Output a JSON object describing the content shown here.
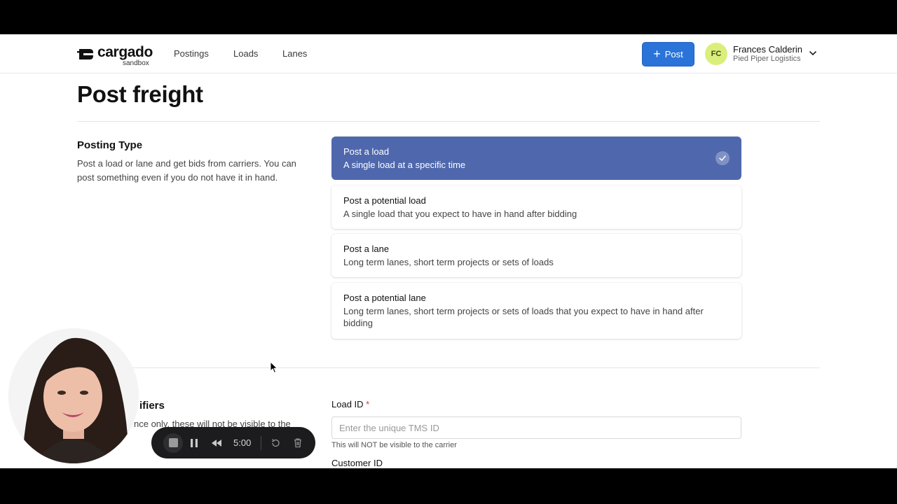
{
  "header": {
    "logo_text": "cargado",
    "logo_sub": "sandbox",
    "nav": [
      "Postings",
      "Loads",
      "Lanes"
    ],
    "post_button": "Post",
    "user_initials": "FC",
    "user_name": "Frances Calderin",
    "user_org": "Pied Piper Logistics"
  },
  "page": {
    "title": "Post freight"
  },
  "posting_type": {
    "title": "Posting Type",
    "description": "Post a load or lane and get bids from carriers. You can post something even if you do not have it in hand.",
    "options": [
      {
        "title": "Post a load",
        "description": "A single load at a specific time",
        "selected": true
      },
      {
        "title": "Post a potential load",
        "description": "A single load that you expect to have in hand after bidding",
        "selected": false
      },
      {
        "title": "Post a lane",
        "description": "Long term lanes, short term projects or sets of loads",
        "selected": false
      },
      {
        "title": "Post a potential lane",
        "description": "Long term lanes, short term projects or sets of loads that you expect to have in hand after bidding",
        "selected": false
      }
    ]
  },
  "identifiers": {
    "title_partial": "ifiers",
    "description_partial": "nce only, these will not be visible to the",
    "load_id_label": "Load ID",
    "required_mark": "*",
    "load_id_placeholder": "Enter the unique TMS ID",
    "load_id_value": "",
    "load_id_help": "This will NOT be visible to the carrier",
    "customer_id_label": "Customer ID"
  },
  "recorder": {
    "time": "5:00"
  },
  "colors": {
    "accent": "#2a73d9",
    "selected_option": "#4f68ad",
    "avatar": "#d9ef7a",
    "required": "#e0342e"
  }
}
